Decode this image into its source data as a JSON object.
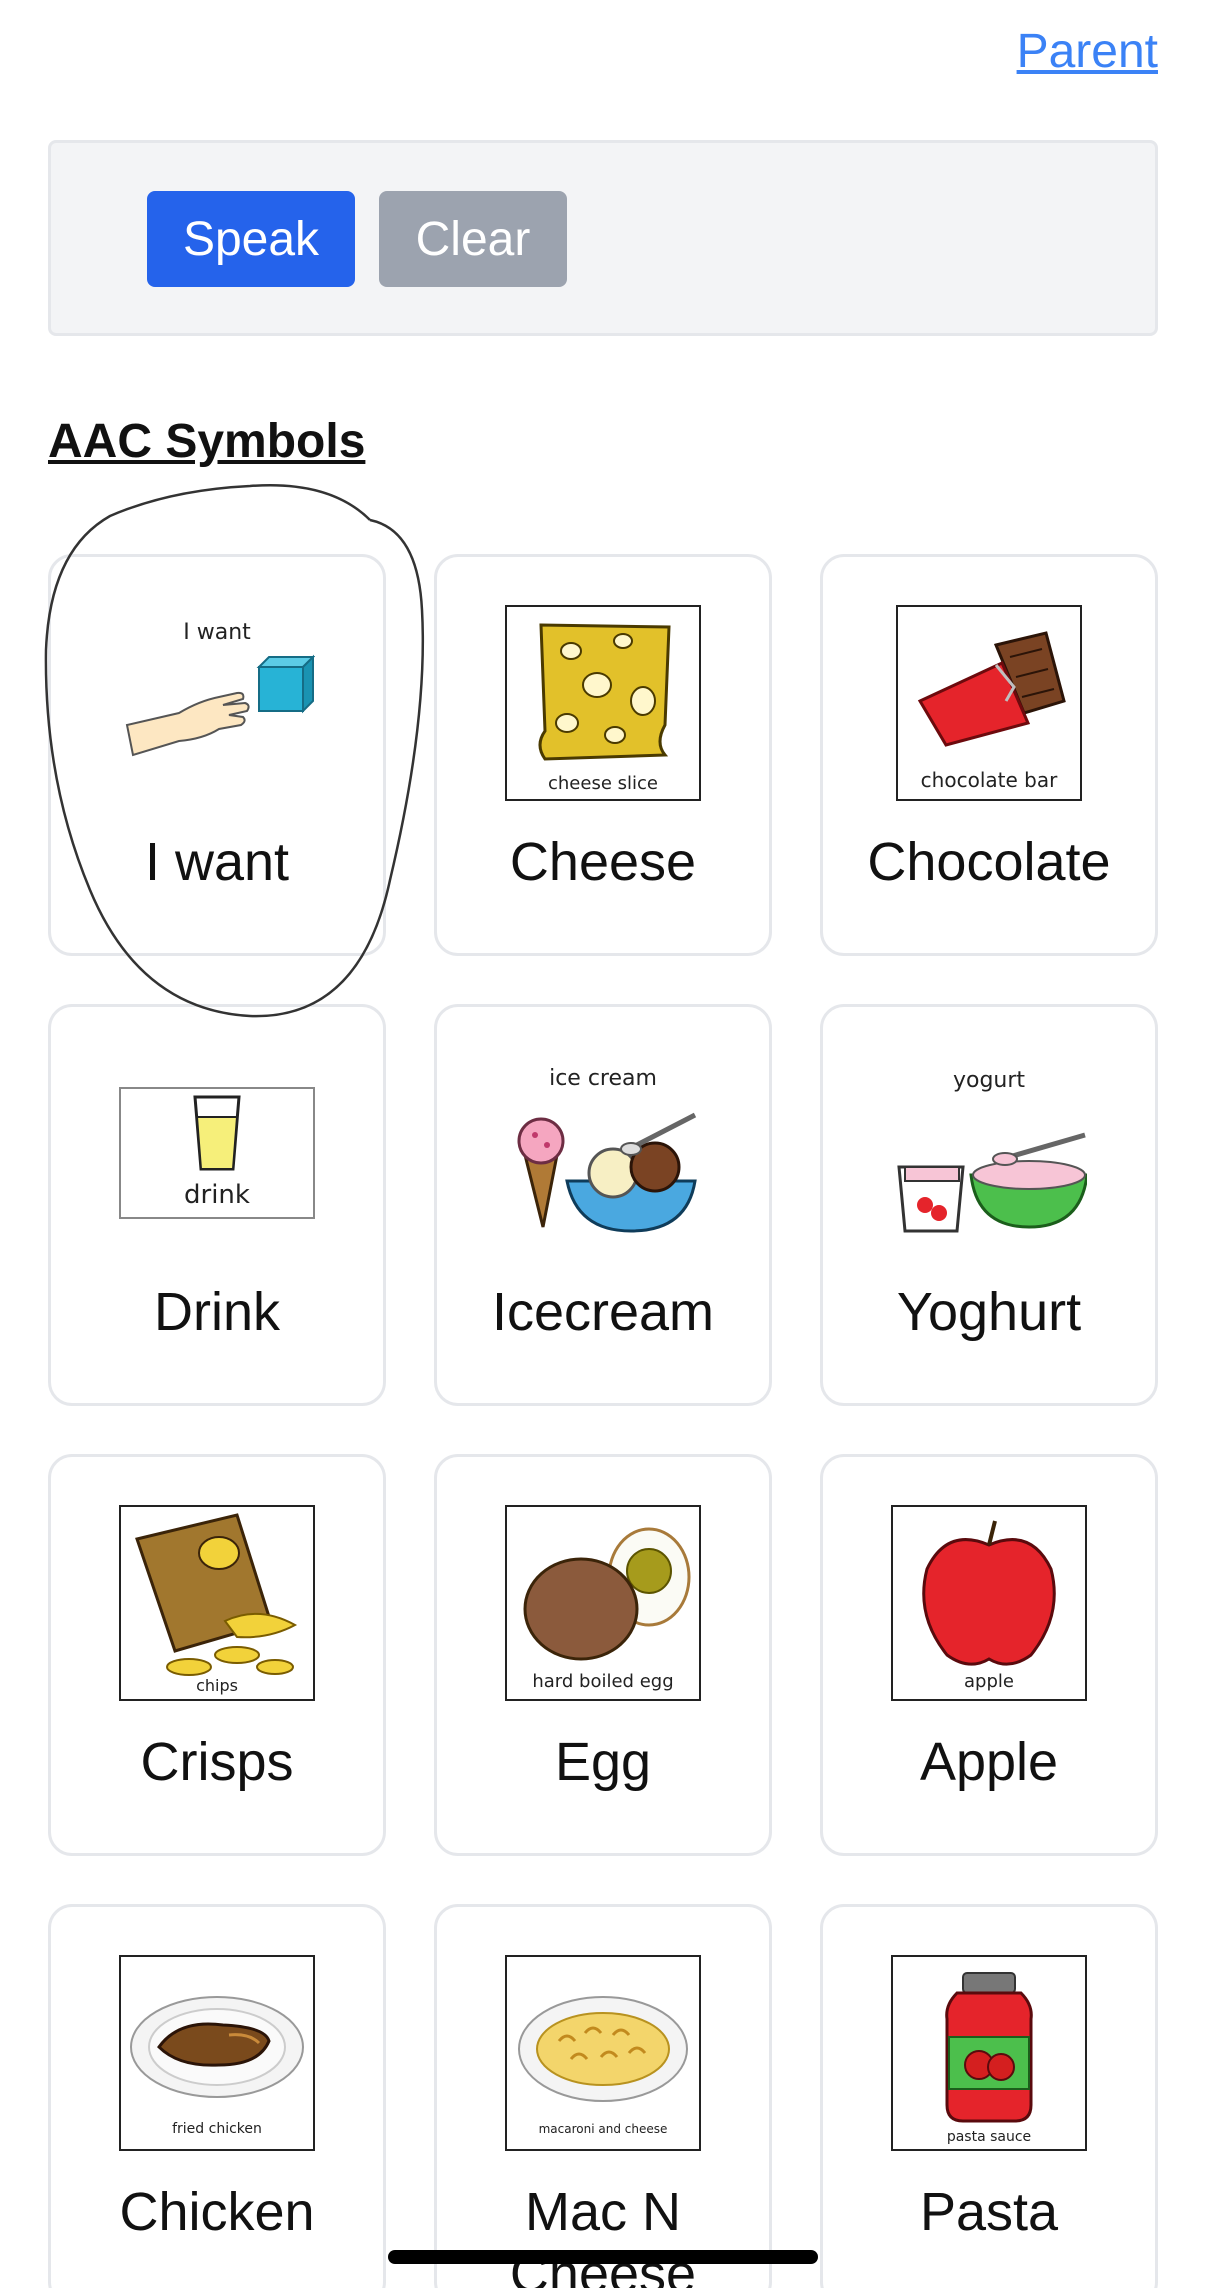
{
  "header": {
    "parent_link": "Parent"
  },
  "speech_bar": {
    "speak_label": "Speak",
    "clear_label": "Clear"
  },
  "section": {
    "title": "AAC Symbols"
  },
  "symbols": [
    {
      "label": "I want",
      "caption": "I want",
      "icon": "hand-reaching-cube-icon"
    },
    {
      "label": "Cheese",
      "caption": "cheese slice",
      "icon": "cheese-icon"
    },
    {
      "label": "Chocolate",
      "caption": "chocolate bar",
      "icon": "chocolate-icon"
    },
    {
      "label": "Drink",
      "caption": "drink",
      "icon": "drink-glass-icon"
    },
    {
      "label": "Icecream",
      "caption": "ice cream",
      "icon": "ice-cream-icon"
    },
    {
      "label": "Yoghurt",
      "caption": "yogurt",
      "icon": "yogurt-icon"
    },
    {
      "label": "Crisps",
      "caption": "chips",
      "icon": "chips-bag-icon"
    },
    {
      "label": "Egg",
      "caption": "hard boiled egg",
      "icon": "egg-icon"
    },
    {
      "label": "Apple",
      "caption": "apple",
      "icon": "apple-icon"
    },
    {
      "label": "Chicken",
      "caption": "fried chicken",
      "icon": "chicken-plate-icon"
    },
    {
      "label": "Mac N Cheese",
      "caption": "macaroni and cheese",
      "icon": "mac-cheese-plate-icon"
    },
    {
      "label": "Pasta",
      "caption": "pasta sauce",
      "icon": "pasta-sauce-jar-icon"
    }
  ],
  "colors": {
    "link": "#3b82f6",
    "speak_button": "#2563eb",
    "clear_button": "#9ca3af",
    "card_border": "#e5e7eb",
    "bar_background": "#f3f4f6"
  }
}
